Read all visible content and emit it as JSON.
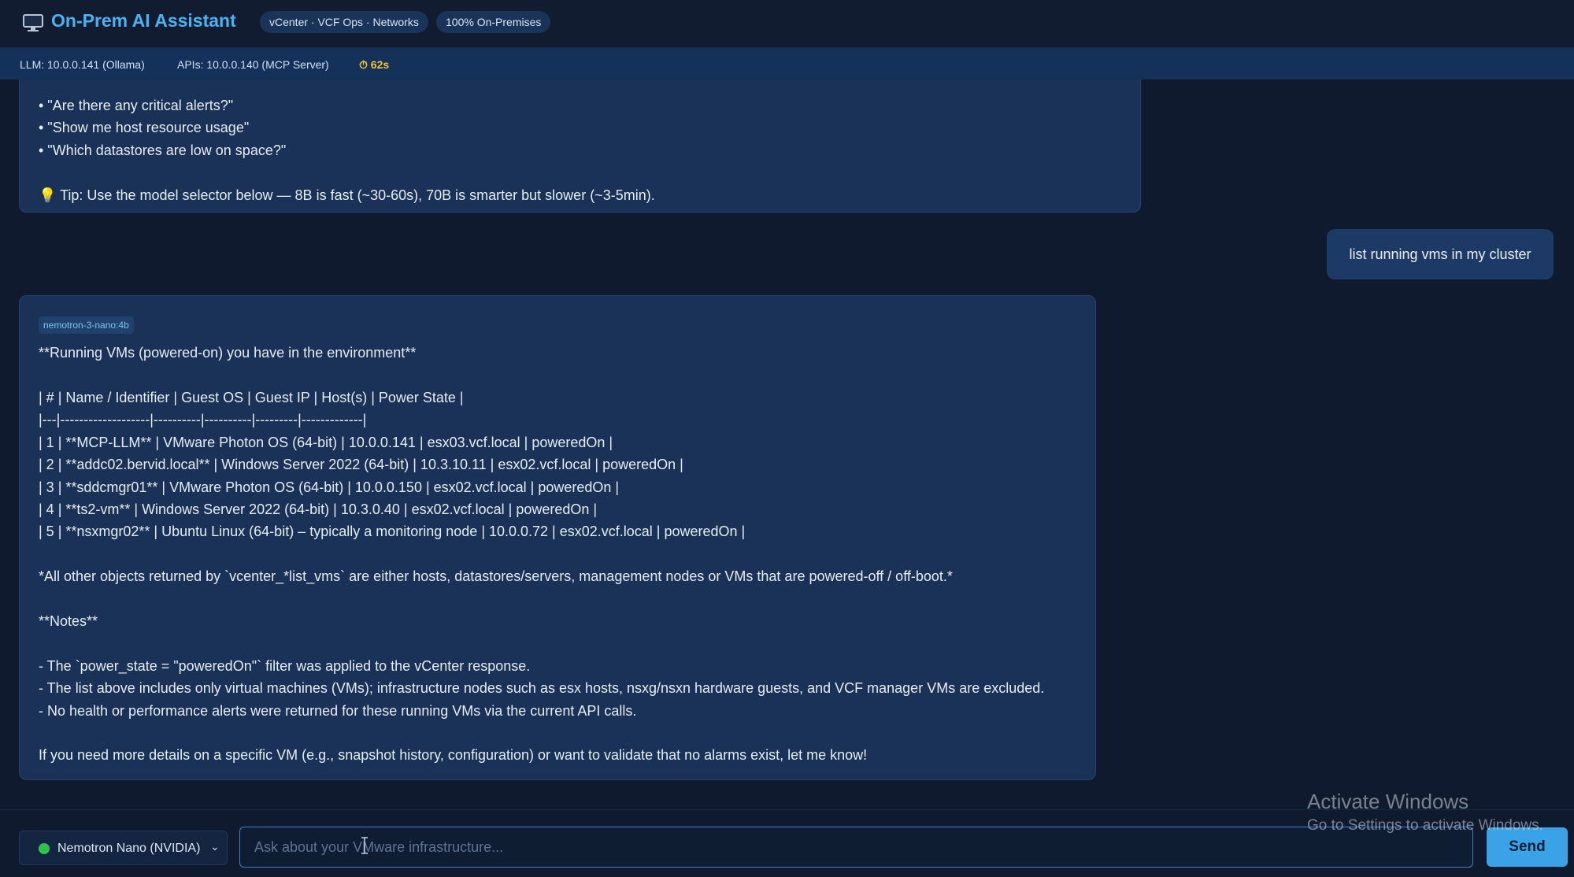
{
  "header": {
    "title": "On-Prem AI Assistant",
    "badges": [
      "vCenter · VCF Ops · Networks",
      "100% On-Premises"
    ]
  },
  "statusbar": {
    "llm": "LLM: 10.0.0.141 (Ollama)",
    "apis": "APIs: 10.0.0.140 (MCP Server)",
    "timer": "⏱ 62s"
  },
  "messages": {
    "welcome_lines": [
      "• \"Are there any critical alerts?\"",
      "• \"Show me host resource usage\"",
      "• \"Which datastores are low on space?\"",
      "💡 Tip: Use the model selector below — 8B is fast (~30-60s), 70B is smarter but slower (~3-5min)."
    ],
    "user_message": "list running vms in my cluster",
    "assistant": {
      "model_tag": "nemotron-3-nano:4b",
      "lines": [
        "**Running VMs (powered-on) you have in the environment**",
        "| # | Name / Identifier | Guest OS | Guest IP | Host(s) | Power State |",
        "|---|-------------------|----------|----------|---------|-------------|",
        "| 1 | **MCP-LLM** | VMware Photon OS (64-bit) | 10.0.0.141 | esx03.vcf.local | poweredOn |",
        "| 2 | **addc02.bervid.local** | Windows Server 2022 (64-bit) | 10.3.10.11 | esx02.vcf.local | poweredOn |",
        "| 3 | **sddcmgr01** | VMware Photon OS (64-bit) | 10.0.0.150 | esx02.vcf.local | poweredOn |",
        "| 4 | **ts2-vm** | Windows Server 2022 (64-bit) | 10.3.0.40 | esx02.vcf.local | poweredOn |",
        "| 5 | **nsxmgr02** | Ubuntu Linux (64-bit) – typically a monitoring node | 10.0.0.72 | esx02.vcf.local | poweredOn |",
        "*All other objects returned by `vcenter_*list_vms` are either hosts, datastores/servers, management nodes or VMs that are powered-off / off-boot.*",
        "**Notes**",
        "- The `power_state = \"poweredOn\"` filter was applied to the vCenter response.",
        "- The list above includes only virtual machines (VMs); infrastructure nodes such as esx hosts, nsxg/nsxn hardware guests, and VCF manager VMs are excluded.",
        "- No health or performance alerts were returned for these running VMs via the current API calls.",
        "If you need more details on a specific VM (e.g., snapshot history, configuration) or want to validate that no alarms exist, let me know!"
      ]
    }
  },
  "watermark": {
    "line1": "Activate Windows",
    "line2": "Go to Settings to activate Windows."
  },
  "input": {
    "model": "Nemotron Nano (NVIDIA)",
    "placeholder": "Ask about your VMware infrastructure...",
    "send_label": "Send"
  }
}
